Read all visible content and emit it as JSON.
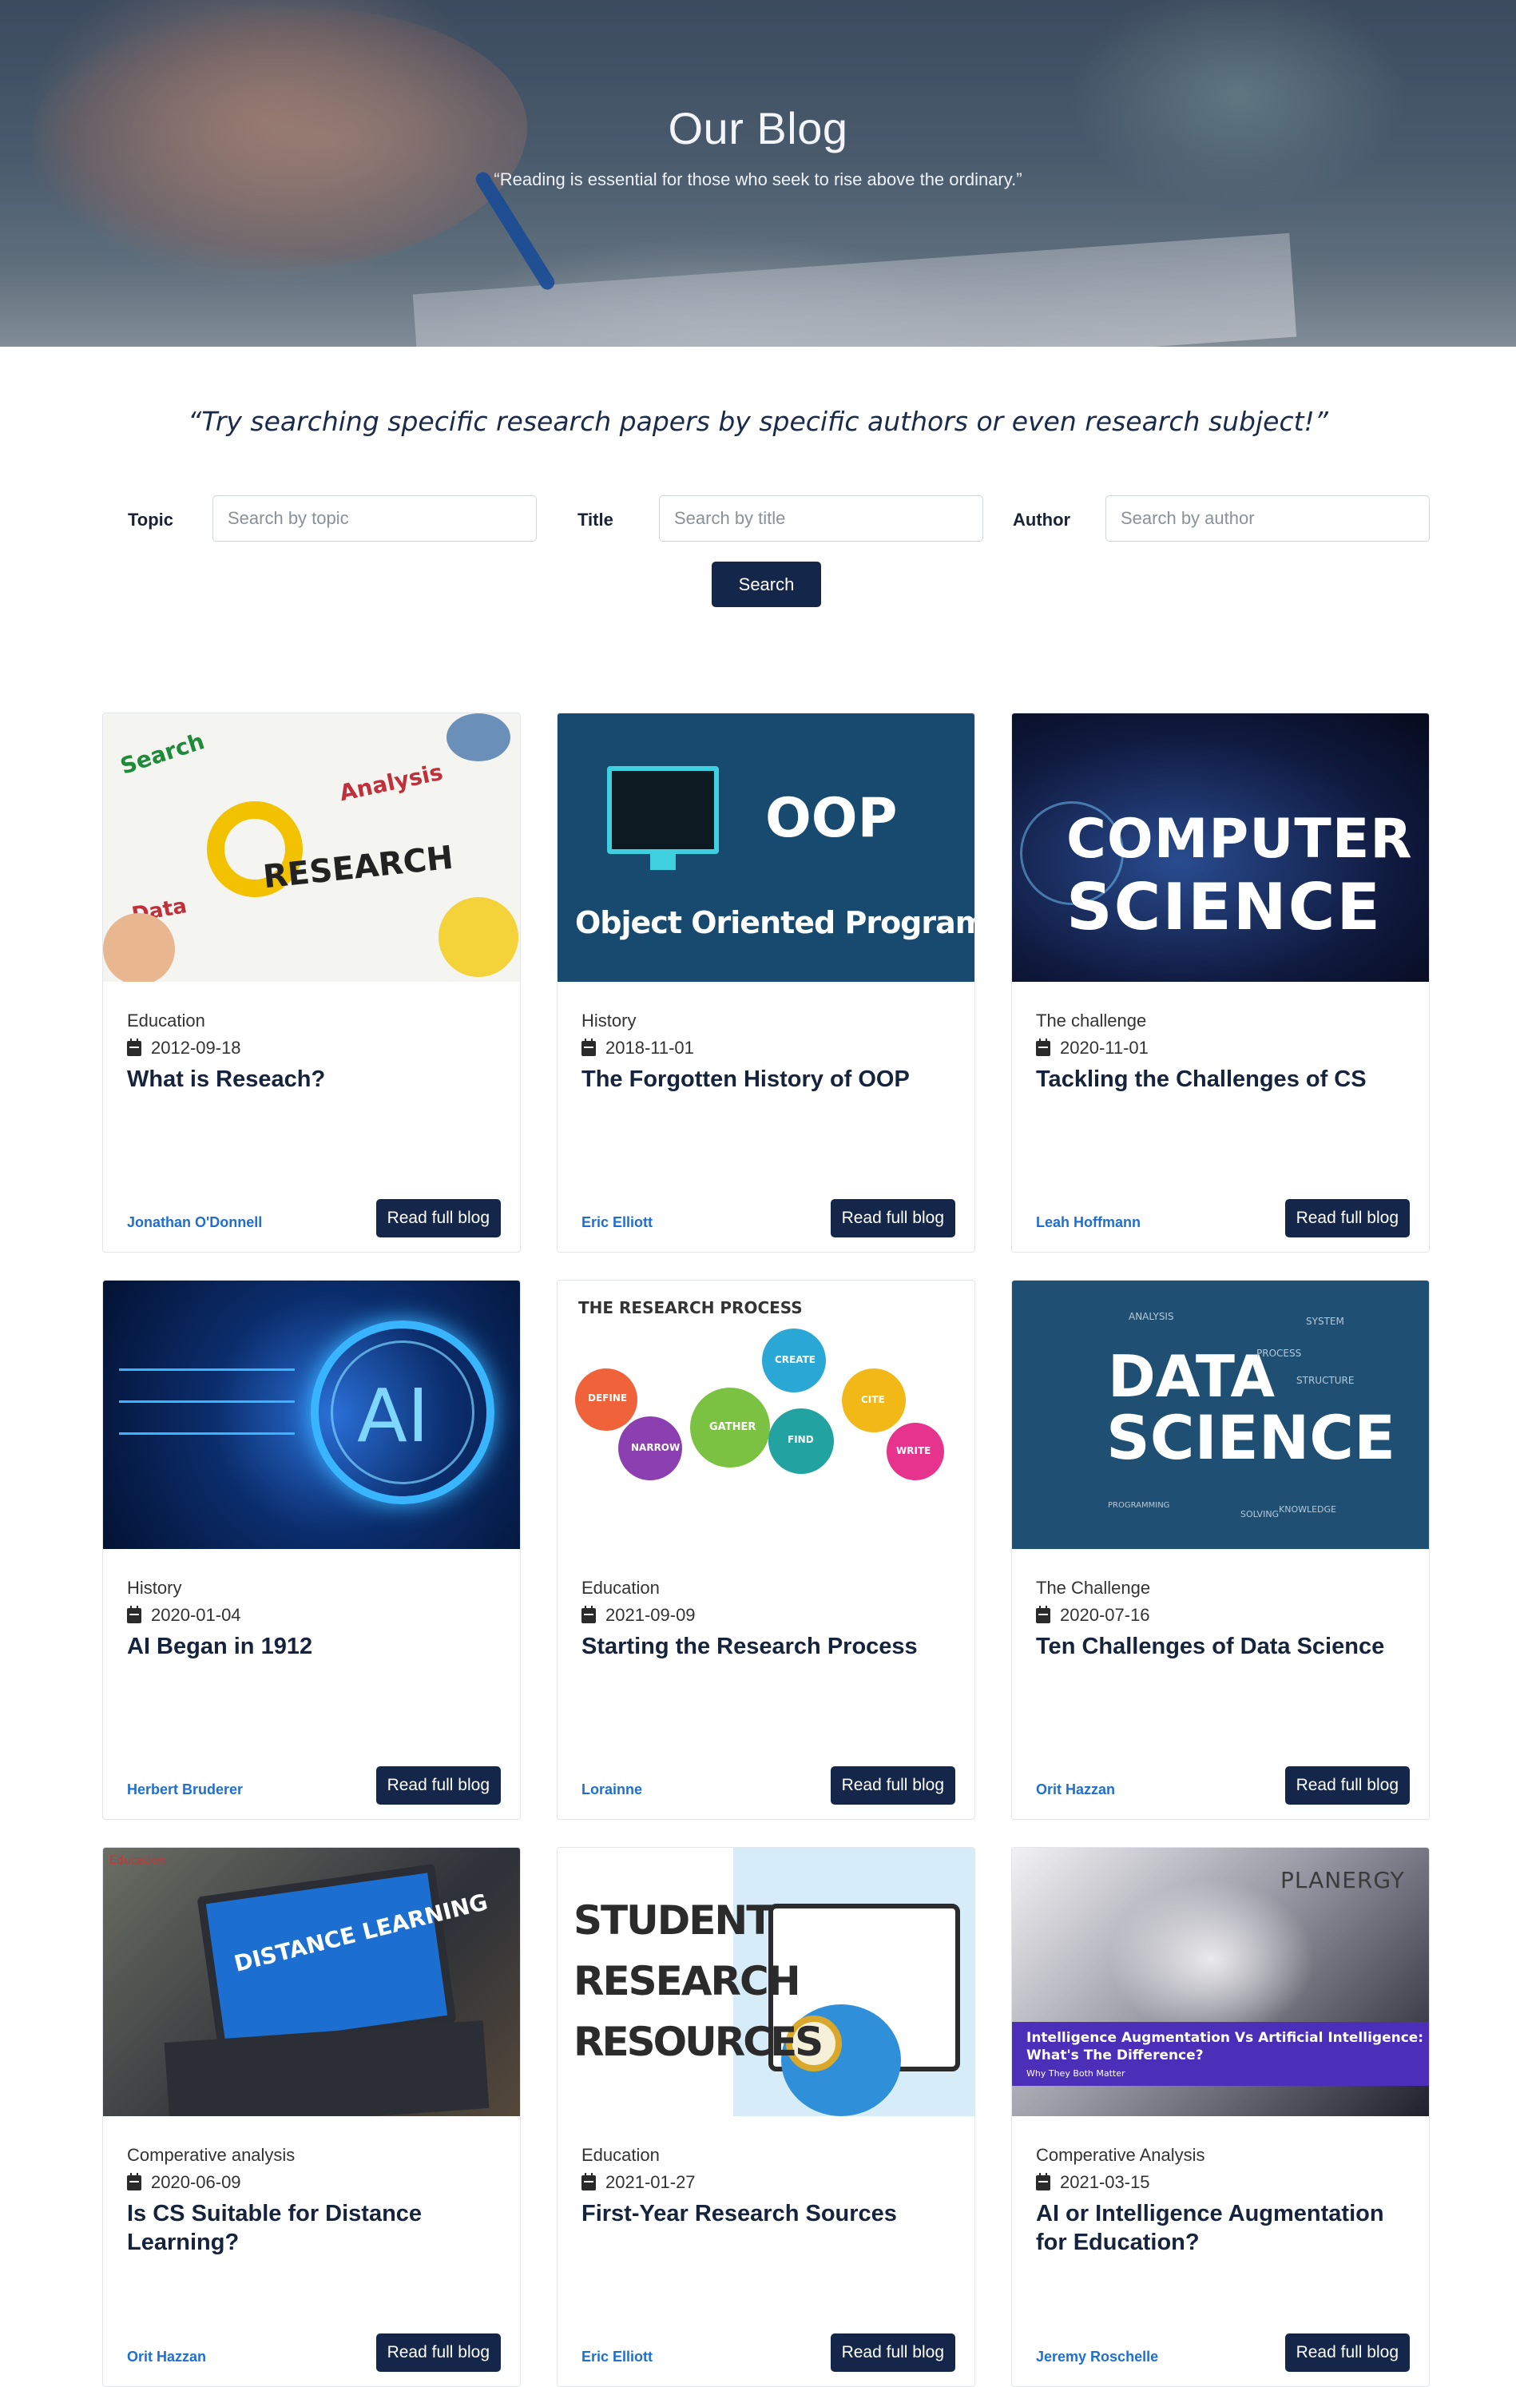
{
  "hero": {
    "title": "Our Blog",
    "quote": "“Reading is essential for those who seek to rise above the ordinary.”"
  },
  "intro": "“Try searching specific research papers by specific authors or even research subject!”",
  "search": {
    "topic_label": "Topic",
    "topic_placeholder": "Search by topic",
    "title_label": "Title",
    "title_placeholder": "Search by title",
    "author_label": "Author",
    "author_placeholder": "Search by author",
    "button": "Search"
  },
  "read_label": "Read full blog",
  "posts": [
    {
      "category": "Education",
      "date": "2012-09-18",
      "title": "What is Reseach?",
      "author": "Jonathan O'Donnell",
      "thumb_text": [
        "Search",
        "Analysis",
        "RESEARCH",
        "Data"
      ]
    },
    {
      "category": "History",
      "date": "2018-11-01",
      "title": "The Forgotten History of OOP",
      "author": "Eric Elliott",
      "thumb_text": [
        "OOP",
        "Object Oriented Programming"
      ]
    },
    {
      "category": "The challenge",
      "date": "2020-11-01",
      "title": "Tackling the Challenges of CS",
      "author": "Leah Hoffmann",
      "thumb_text": [
        "COMPUTER",
        "SCIENCE"
      ]
    },
    {
      "category": "History",
      "date": "2020-01-04",
      "title": "AI Began in 1912",
      "author": "Herbert Bruderer",
      "thumb_text": [
        "AI"
      ]
    },
    {
      "category": "Education",
      "date": "2021-09-09",
      "title": "Starting the Research Process",
      "author": "Lorainne",
      "thumb_text": [
        "THE RESEARCH PROCESS",
        "DEFINE",
        "NARROW",
        "GATHER",
        "CREATE",
        "FIND",
        "CITE",
        "WRITE"
      ]
    },
    {
      "category": "The Challenge",
      "date": "2020-07-16",
      "title": "Ten Challenges of Data Science",
      "author": "Orit Hazzan",
      "thumb_text": [
        "DATA",
        "SCIENCE",
        "ANALYSIS",
        "SYSTEM",
        "PROCESS",
        "STRUCTURE",
        "PROGRAMMING",
        "SOLVING",
        "KNOWLEDGE"
      ]
    },
    {
      "category": "Comperative analysis",
      "date": "2020-06-09",
      "title": "Is CS Suitable for Distance Learning?",
      "author": "Orit Hazzan",
      "thumb_text": [
        "DISTANCE LEARNING",
        "Education"
      ]
    },
    {
      "category": "Education",
      "date": "2021-01-27",
      "title": "First-Year Research Sources",
      "author": "Eric Elliott",
      "thumb_text": [
        "STUDENT",
        "RESEARCH",
        "RESOURCES"
      ]
    },
    {
      "category": "Comperative Analysis",
      "date": "2021-03-15",
      "title": "AI or Intelligence Augmentation for Education?",
      "author": "Jeremy Roschelle",
      "thumb_text": [
        "PLANERGY",
        "Intelligence Augmentation Vs Artificial Intelligence:",
        "What's The Difference?",
        "Why They Both Matter"
      ]
    }
  ],
  "colors": {
    "navy": "#14264a",
    "author_blue": "#1f6fd1",
    "title_text": "#16233d"
  }
}
